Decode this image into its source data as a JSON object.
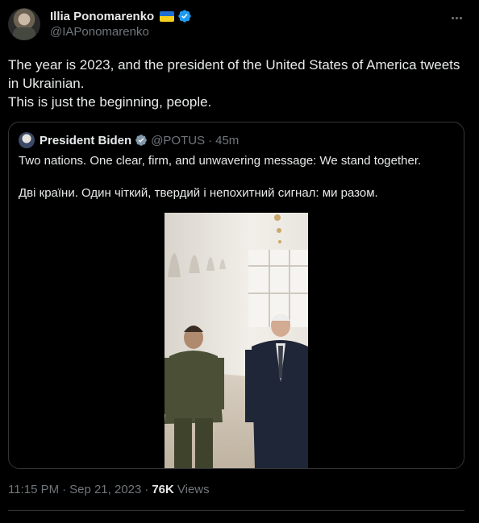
{
  "author": {
    "display_name": "Illia Ponomarenko",
    "handle": "@IAPonomarenko",
    "flag_icon": "ukraine-flag-icon",
    "verified_icon": "verified-badge-icon",
    "verified_color": "#1d9bf0"
  },
  "tweet": {
    "text_lines": [
      "The year is 2023, and the president of the United States of America tweets in Ukrainian.",
      "This is just the beginning, people."
    ]
  },
  "quote": {
    "display_name": "President Biden",
    "handle": "@POTUS",
    "separator": "·",
    "time": "45m",
    "verified_icon": "verified-badge-gray-icon",
    "paragraphs": [
      "Two nations. One clear, firm, and unwavering message: We stand together.",
      "Дві країни. Один чіткий, твердий і непохитний сигнал: ми разом."
    ],
    "media_icon": "photo-two-presidents-walking"
  },
  "meta": {
    "time": "11:15 PM",
    "separator": "·",
    "date": "Sep 21, 2023",
    "separator2": "·",
    "views_count": "76K",
    "views_label": "Views"
  },
  "colors": {
    "background": "#000000",
    "text": "#e7e9ea",
    "muted": "#71767b",
    "border": "#333639"
  }
}
